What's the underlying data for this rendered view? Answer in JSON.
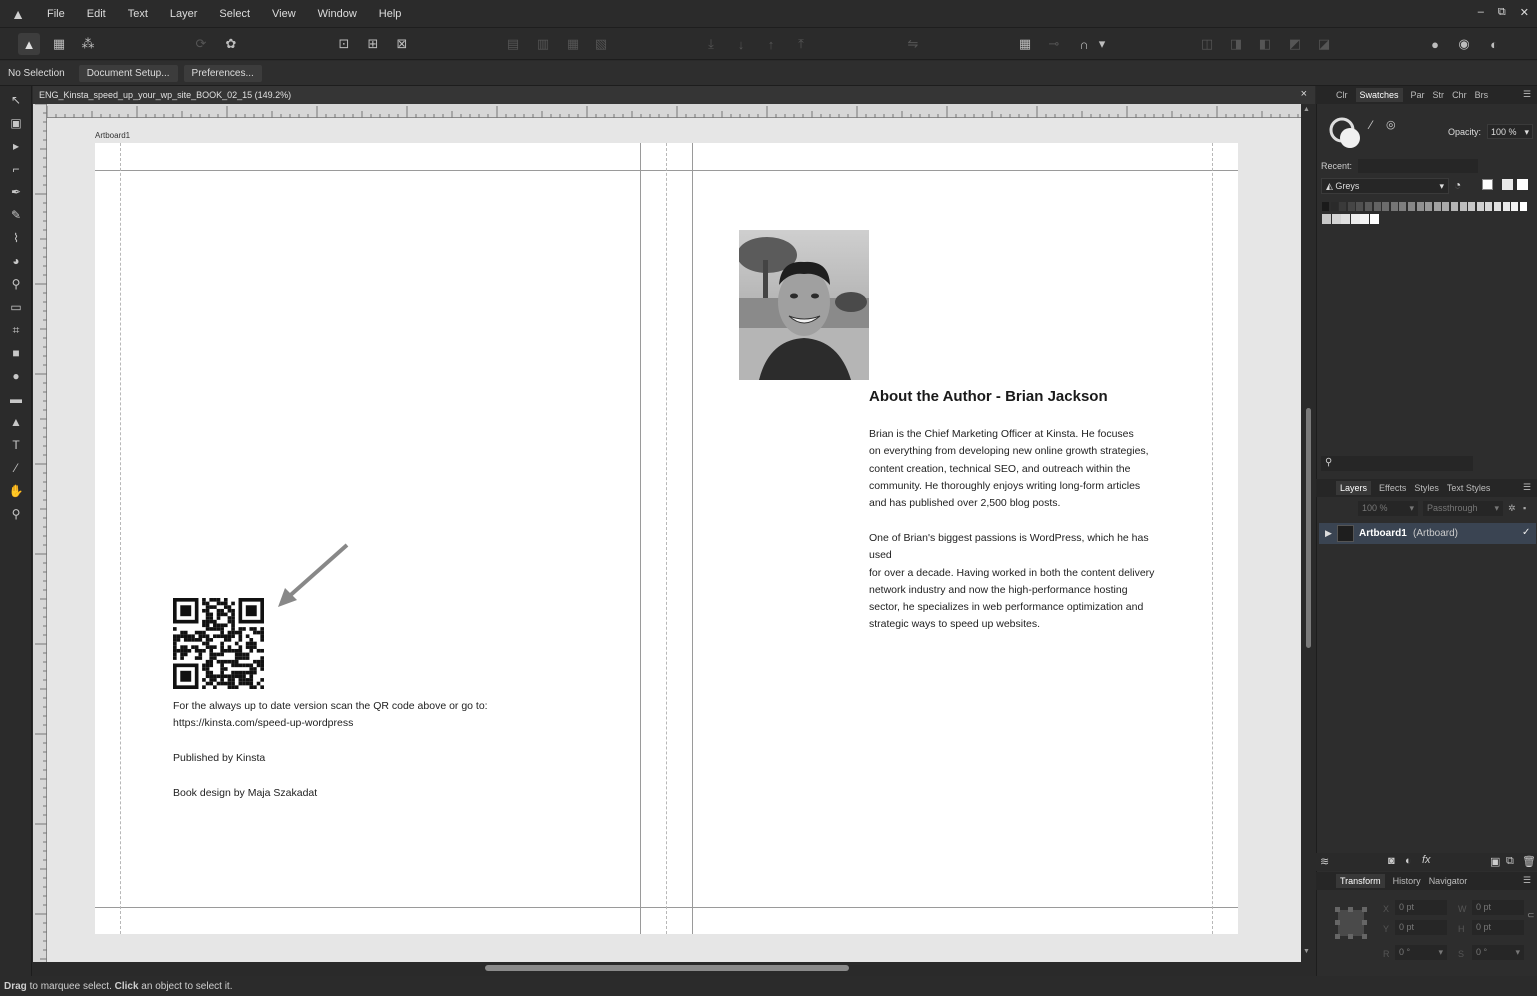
{
  "app": {
    "logo": "affinity-designer-logo"
  },
  "menu": [
    "File",
    "Edit",
    "Text",
    "Layer",
    "Select",
    "View",
    "Window",
    "Help"
  ],
  "window_controls": {
    "min": "–",
    "max": "⧉",
    "close": "✕"
  },
  "context_bar": {
    "selection": "No Selection",
    "document_setup": "Document Setup...",
    "preferences": "Preferences..."
  },
  "document": {
    "tab_title": "ENG_Kinsta_speed_up_your_wp_site_BOOK_02_15 (149.2%)",
    "close": "×"
  },
  "artboard": {
    "label": "Artboard1"
  },
  "left_page": {
    "qr_line1": "For the always up to date version scan the QR code above or go to:",
    "qr_line2": "https://kinsta.com/speed-up-wordpress",
    "published": "Published by Kinsta",
    "design": "Book design by Maja Szakadat"
  },
  "right_page": {
    "title": "About the Author - Brian Jackson",
    "bio1": [
      "Brian is the Chief Marketing Officer at Kinsta. He focuses",
      "on everything from developing new online growth strategies,",
      "content creation, technical SEO, and outreach within the",
      "community.  He thoroughly enjoys writing long-form articles",
      "and has published over 2,500 blog posts."
    ],
    "bio2": [
      "One of Brian's biggest passions is WordPress, which he has used",
      "for over a decade. Having worked in both the content delivery",
      "network industry and now the high-performance hosting",
      "sector, he specializes in web performance optimization and",
      "strategic ways to speed up websites."
    ]
  },
  "swatch_panel": {
    "tabs": [
      "Clr",
      "Swatches",
      "Par",
      "Str",
      "Chr",
      "Brs"
    ],
    "opacity_label": "Opacity:",
    "opacity_value": "100 %",
    "recent_label": "Recent:",
    "palette": "Greys"
  },
  "layers_panel": {
    "tabs": [
      "Layers",
      "Effects",
      "Styles",
      "Text Styles"
    ],
    "opacity_value": "100 %",
    "blend_mode": "Passthrough",
    "layer_name": "Artboard1",
    "layer_type": "(Artboard)"
  },
  "transform_panel": {
    "tabs": [
      "Transform",
      "History",
      "Navigator"
    ],
    "x": "0 pt",
    "y": "0 pt",
    "w": "0 pt",
    "h": "0 pt",
    "r": "0 °",
    "s": "0 °"
  },
  "status": {
    "drag": "Drag",
    "text1": " to marquee select. ",
    "click": "Click",
    "text2": " an object to select it."
  },
  "colors": {
    "app_bg": "#2b2b2b",
    "canvas": "#e6e6e6",
    "page": "#ffffff",
    "accent": "#4a90d9"
  }
}
